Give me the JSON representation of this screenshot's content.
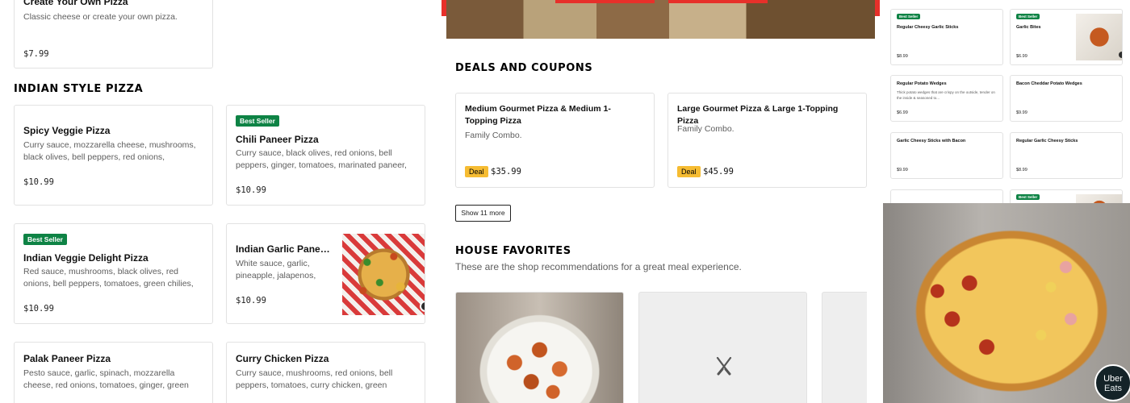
{
  "menu": {
    "top_item": {
      "title": "Create Your Own Pizza",
      "description": "Classic cheese or create your own pizza.",
      "price": "$7.99"
    },
    "indian_section_title": "INDIAN STYLE PIZZA",
    "indian_items": [
      {
        "title": "Spicy Veggie Pizza",
        "description": "Curry sauce, mozzarella cheese, mushrooms, black olives, bell peppers, red onions, tomatoes,...",
        "price": "$10.99",
        "badge": ""
      },
      {
        "title": "Chili Paneer Pizza",
        "description": "Curry sauce, black olives, red onions, bell peppers, ginger, tomatoes, marinated paneer, fre...",
        "price": "$10.99",
        "badge": "Best Seller"
      },
      {
        "title": "Indian Veggie Delight Pizza",
        "description": "Red sauce, mushrooms, black olives, red onions, bell peppers, tomatoes, green chilies, ginger,...",
        "price": "$10.99",
        "badge": "Best Seller"
      },
      {
        "title": "Indian Garlic Paneer...",
        "description": "White sauce, garlic, pineapple, jalapenos, red...",
        "price": "$10.99",
        "badge": ""
      },
      {
        "title": "Palak Paneer Pizza",
        "description": "Pesto sauce, garlic, spinach, mozzarella cheese, red onions, tomatoes, ginger, green chilies, pane...",
        "price": "",
        "badge": ""
      },
      {
        "title": "Curry Chicken Pizza",
        "description": "Curry sauce, mushrooms, red onions, bell peppers, tomatoes, curry chicken, green chilies,...",
        "price": "",
        "badge": ""
      }
    ]
  },
  "deals": {
    "title": "DEALS AND COUPONS",
    "items": [
      {
        "title": "Medium Gourmet Pizza & Medium 1-Topping Pizza",
        "subtitle": "Family Combo.",
        "tag": "Deal",
        "price": "$35.99"
      },
      {
        "title": "Large Gourmet Pizza & Large 1-Topping Pizza",
        "subtitle": "Family Combo.",
        "tag": "Deal",
        "price": "$45.99"
      }
    ],
    "show_more": "Show 11 more"
  },
  "favorites": {
    "title": "HOUSE FAVORITES",
    "subtitle": "These are the shop recommendations for a great meal experience."
  },
  "side_items": [
    {
      "title": "Regular Cheesy Garlic Sticks",
      "price": "$8.99",
      "badge": "Best Seller",
      "desc": ""
    },
    {
      "title": "Garlic Bites",
      "price": "$6.99",
      "badge": "Best Seller",
      "desc": ""
    },
    {
      "title": "Regular Potato Wedges",
      "price": "$6.99",
      "badge": "",
      "desc": "Thick potato wedges that are crispy on the outside, tender on the inside & seasoned to..."
    },
    {
      "title": "Bacon Cheddar Potato Wedges",
      "price": "$9.99",
      "badge": "",
      "desc": ""
    },
    {
      "title": "Garlic Cheesy Sticks with Bacon",
      "price": "$9.99",
      "badge": "",
      "desc": ""
    },
    {
      "title": "Regular Garlic Cheesy Sticks",
      "price": "$8.99",
      "badge": "",
      "desc": ""
    }
  ],
  "side_partial_badge": "Best Seller",
  "uber_eats": {
    "line1": "Uber",
    "line2": "Eats"
  },
  "icons": {
    "utensils": "fork-knife-icon"
  },
  "colors": {
    "badge_green": "#0e8345",
    "deal_yellow": "#f6bc32",
    "brand_red": "#e7302a"
  }
}
